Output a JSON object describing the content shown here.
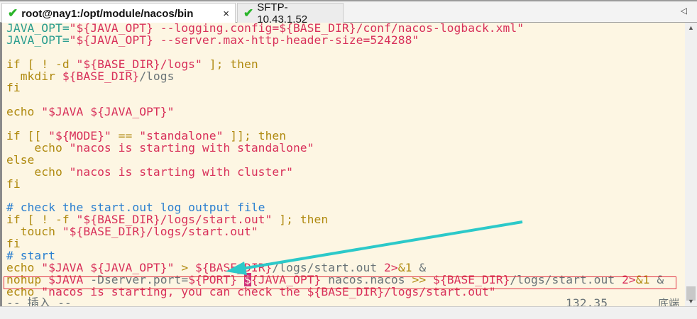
{
  "tabs": [
    {
      "label": "root@nay1:/opt/module/nacos/bin",
      "close": "×",
      "icon": "check-icon"
    },
    {
      "label": "SFTP-10.43.1.52",
      "icon": "check-icon"
    }
  ],
  "tab_nav": "◁",
  "lines": [
    [
      [
        "JAVA_OPT=",
        "v"
      ],
      [
        "\"${JAVA_OPT} --logging.config=${BASE_DIR}/conf/nacos-logback.xml\"",
        "s"
      ]
    ],
    [
      [
        "JAVA_OPT=",
        "v"
      ],
      [
        "\"${JAVA_OPT} --server.max-http-header-size=524288\"",
        "s"
      ]
    ],
    [],
    [
      [
        "if [ ! -d ",
        "k"
      ],
      [
        "\"${BASE_DIR}/logs\"",
        "s"
      ],
      [
        " ]; then",
        "k"
      ]
    ],
    [
      [
        "  mkdir ",
        "k"
      ],
      [
        "${BASE_DIR}",
        "s"
      ],
      [
        "/logs",
        "p"
      ]
    ],
    [
      [
        "fi",
        "k"
      ]
    ],
    [],
    [
      [
        "echo ",
        "k"
      ],
      [
        "\"$JAVA ${JAVA_OPT}\"",
        "s"
      ]
    ],
    [],
    [
      [
        "if [[ ",
        "k"
      ],
      [
        "\"${MODE}\"",
        "s"
      ],
      [
        " == ",
        "k"
      ],
      [
        "\"standalone\"",
        "s"
      ],
      [
        " ]]; then",
        "k"
      ]
    ],
    [
      [
        "    echo ",
        "k"
      ],
      [
        "\"nacos is starting with standalone\"",
        "s"
      ]
    ],
    [
      [
        "else",
        "k"
      ]
    ],
    [
      [
        "    echo ",
        "k"
      ],
      [
        "\"nacos is starting with cluster\"",
        "s"
      ]
    ],
    [
      [
        "fi",
        "k"
      ]
    ],
    [],
    [
      [
        "# check the start.out log output file",
        "c"
      ]
    ],
    [
      [
        "if [ ! -f ",
        "k"
      ],
      [
        "\"${BASE_DIR}/logs/start.out\"",
        "s"
      ],
      [
        " ]; then",
        "k"
      ]
    ],
    [
      [
        "  touch ",
        "k"
      ],
      [
        "\"${BASE_DIR}/logs/start.out\"",
        "s"
      ]
    ],
    [
      [
        "fi",
        "k"
      ]
    ],
    [
      [
        "# start",
        "c"
      ]
    ],
    [
      [
        "echo ",
        "k"
      ],
      [
        "\"$JAVA ${JAVA_OPT}\"",
        "s"
      ],
      [
        " > ",
        "k"
      ],
      [
        "${BASE_DIR}",
        "s"
      ],
      [
        "/logs/start.out ",
        "p"
      ],
      [
        "2>",
        "s"
      ],
      [
        "&1",
        "k"
      ],
      [
        " &",
        "p"
      ]
    ],
    [
      [
        "nohup ",
        "k"
      ],
      [
        "$JAVA ",
        "s"
      ],
      [
        "-Dserver.port=",
        "p"
      ],
      [
        "${PORT} ",
        "s"
      ],
      [
        "$",
        "cur"
      ],
      [
        "{JAVA_OPT} ",
        "s"
      ],
      [
        "nacos.nacos ",
        "p"
      ],
      [
        ">> ",
        "k"
      ],
      [
        "${BASE_DIR}",
        "s"
      ],
      [
        "/logs/start.out ",
        "p"
      ],
      [
        "2>",
        "s"
      ],
      [
        "&1",
        "k"
      ],
      [
        " &",
        "p"
      ]
    ],
    [
      [
        "echo ",
        "k"
      ],
      [
        "\"nacos is starting, you can check the ${BASE_DIR}/logs/start.out\"",
        "s"
      ]
    ]
  ],
  "status": {
    "mode": "-- 插入 --",
    "position": "132,35",
    "scroll": "底端"
  },
  "colors": {
    "annotation_arrow": "#2cc9c9",
    "highlight_box": "#e03040"
  }
}
